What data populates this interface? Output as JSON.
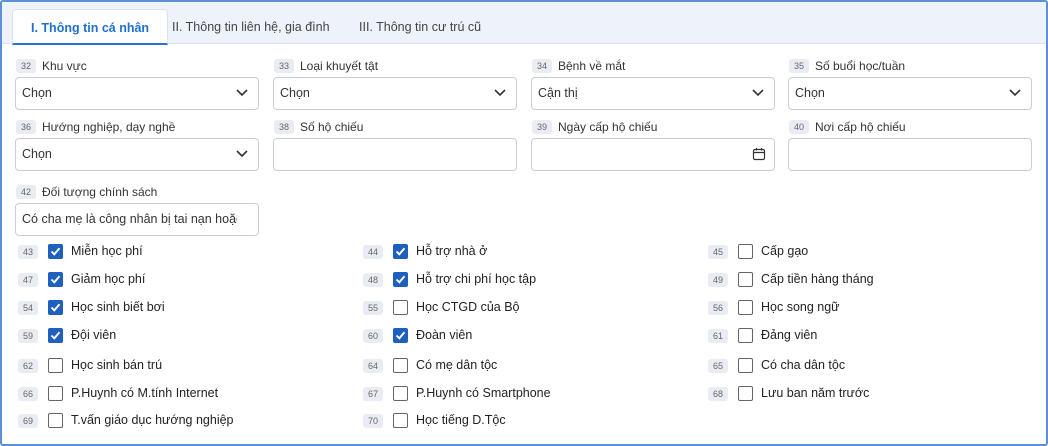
{
  "tabs": [
    {
      "label": "I. Thông tin cá nhân",
      "active": true
    },
    {
      "label": "II. Thông tin liên hệ, gia đình",
      "active": false
    },
    {
      "label": "III. Thông tin cư trú cũ",
      "active": false
    }
  ],
  "fields": {
    "f32": {
      "num": "32",
      "label": "Khu vực",
      "value": "Chọn"
    },
    "f33": {
      "num": "33",
      "label": "Loại khuyết tật",
      "value": "Chọn"
    },
    "f34": {
      "num": "34",
      "label": "Bệnh về mắt",
      "value": "Cận thị"
    },
    "f35": {
      "num": "35",
      "label": "Số buổi học/tuần",
      "value": "Chọn"
    },
    "f36": {
      "num": "36",
      "label": "Hướng nghiệp, dạy nghề",
      "value": "Chọn"
    },
    "f38": {
      "num": "38",
      "label": "Số hộ chiếu",
      "value": ""
    },
    "f39": {
      "num": "39",
      "label": "Ngày cấp hộ chiếu",
      "value": ""
    },
    "f40": {
      "num": "40",
      "label": "Nơi cấp hộ chiếu",
      "value": ""
    },
    "f42": {
      "num": "42",
      "label": "Đối tượng chính sách",
      "value": "Có cha mẹ là công nhân bị tai nạn hoặc"
    }
  },
  "checkboxes": {
    "c43": {
      "num": "43",
      "label": "Miễn học phí",
      "checked": true
    },
    "c44": {
      "num": "44",
      "label": "Hỗ trợ nhà ở",
      "checked": true
    },
    "c45": {
      "num": "45",
      "label": "Cấp gạo",
      "checked": false
    },
    "c47": {
      "num": "47",
      "label": "Giảm học phí",
      "checked": true
    },
    "c48": {
      "num": "48",
      "label": "Hỗ trợ chi phí học tập",
      "checked": true
    },
    "c49": {
      "num": "49",
      "label": "Cấp tiền hàng tháng",
      "checked": false
    },
    "c54": {
      "num": "54",
      "label": "Học sinh biết bơi",
      "checked": true
    },
    "c55": {
      "num": "55",
      "label": "Học CTGD của Bộ",
      "checked": false
    },
    "c56": {
      "num": "56",
      "label": "Học song ngữ",
      "checked": false
    },
    "c59": {
      "num": "59",
      "label": "Đội viên",
      "checked": true
    },
    "c60": {
      "num": "60",
      "label": "Đoàn viên",
      "checked": true
    },
    "c61": {
      "num": "61",
      "label": "Đảng viên",
      "checked": false
    },
    "c62": {
      "num": "62",
      "label": "Học sinh bán trú",
      "checked": false
    },
    "c64": {
      "num": "64",
      "label": "Có mẹ dân tộc",
      "checked": false
    },
    "c65": {
      "num": "65",
      "label": "Có cha dân tộc",
      "checked": false
    },
    "c66": {
      "num": "66",
      "label": "P.Huynh có M.tính Internet",
      "checked": false
    },
    "c67": {
      "num": "67",
      "label": "P.Huynh có Smartphone",
      "checked": false
    },
    "c68": {
      "num": "68",
      "label": "Lưu ban năm trước",
      "checked": false
    },
    "c69": {
      "num": "69",
      "label": "T.vấn giáo dục hướng nghiệp",
      "checked": false
    },
    "c70": {
      "num": "70",
      "label": "Học tiếng D.Tộc",
      "checked": false
    }
  }
}
